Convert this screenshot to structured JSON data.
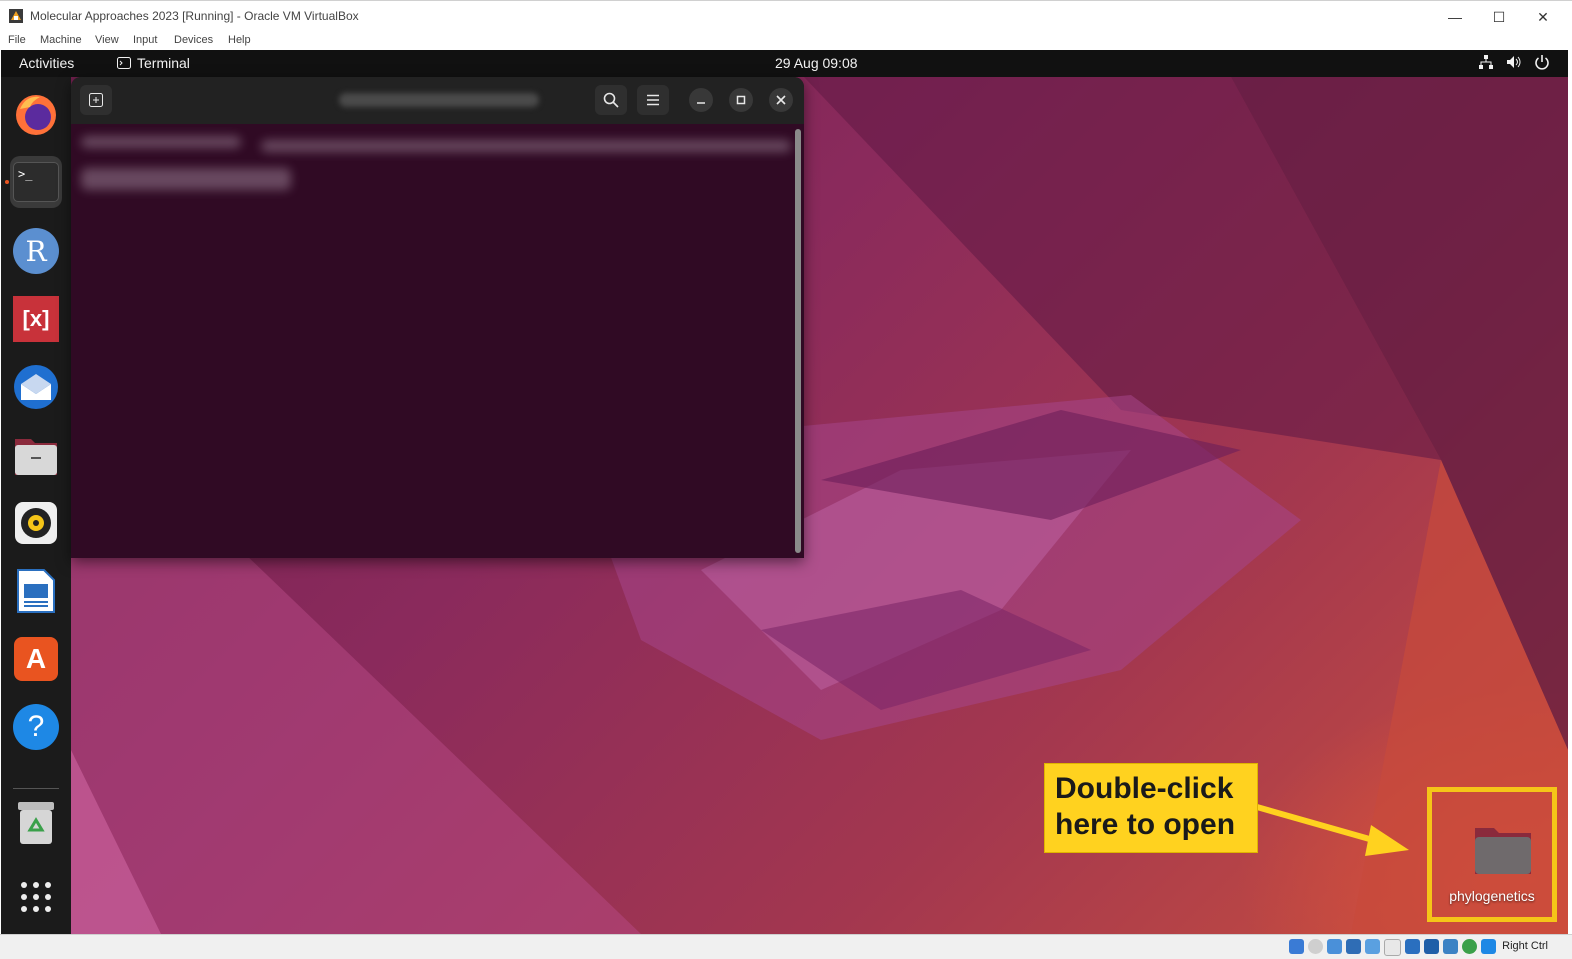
{
  "host_window": {
    "title": "Molecular Approaches 2023 [Running] - Oracle VM VirtualBox",
    "menu": [
      "File",
      "Machine",
      "View",
      "Input",
      "Devices",
      "Help"
    ],
    "controls": {
      "minimize": "—",
      "maximize": "☐",
      "close": "✕"
    }
  },
  "guest_topbar": {
    "activities": "Activities",
    "app_name": "Terminal",
    "clock": "29 Aug  09:08",
    "tray_icons": [
      "network-icon",
      "volume-icon",
      "power-icon"
    ]
  },
  "dock": {
    "items": [
      {
        "name": "firefox",
        "icon": "firefox-icon"
      },
      {
        "name": "terminal",
        "icon": "terminal-icon",
        "active": true,
        "glyph": ">_"
      },
      {
        "name": "r",
        "icon": "r-icon",
        "glyph": "R"
      },
      {
        "name": "mesquite",
        "icon": "mesquite-icon",
        "glyph": "[x]"
      },
      {
        "name": "thunderbird",
        "icon": "thunderbird-icon"
      },
      {
        "name": "files",
        "icon": "files-icon"
      },
      {
        "name": "rhythmbox",
        "icon": "rhythmbox-icon"
      },
      {
        "name": "writer",
        "icon": "writer-icon"
      },
      {
        "name": "app-center",
        "icon": "app-center-icon",
        "glyph": "A"
      },
      {
        "name": "help",
        "icon": "help-icon",
        "glyph": "?"
      },
      {
        "name": "trash",
        "icon": "trash-icon"
      },
      {
        "name": "show-apps",
        "icon": "app-grid-icon"
      }
    ]
  },
  "terminal": {
    "buttons": [
      "new-tab-icon",
      "search-icon",
      "menu-icon",
      "minimize-icon",
      "maximize-icon",
      "close-icon"
    ]
  },
  "desktop": {
    "folder_label": "phylogenetics",
    "callout_line1": "Double-click",
    "callout_line2": "here to open",
    "accent": "#ffd21f"
  },
  "host_status": {
    "host_key": "Right Ctrl"
  },
  "colors": {
    "terminal_bg": "#300a24",
    "ubuntu_orange": "#e95420",
    "highlight_yellow": "#f5c518"
  }
}
